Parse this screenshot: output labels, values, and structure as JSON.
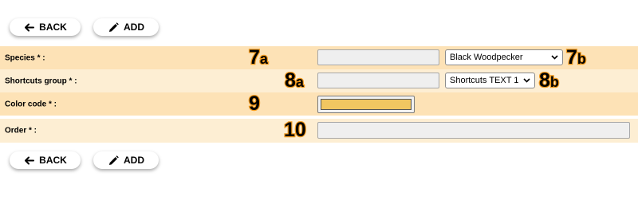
{
  "toolbar_top": {
    "back_label": "BACK",
    "add_label": "ADD"
  },
  "toolbar_bottom": {
    "back_label": "BACK",
    "add_label": "ADD"
  },
  "form": {
    "species": {
      "label": "Species * :",
      "marker_num": "7",
      "marker_letter": "a",
      "input_value": "",
      "select_value": "Black Woodpecker",
      "select_marker_num": "7",
      "select_marker_letter": "b"
    },
    "shortcuts_group": {
      "label": "Shortcuts group * :",
      "marker_num": "8",
      "marker_letter": "a",
      "input_value": "",
      "select_value": "Shortcuts TEXT 1",
      "select_marker_num": "8",
      "select_marker_letter": "b"
    },
    "color_code": {
      "label": "Color code * :",
      "marker_num": "9",
      "color": "#f1c661"
    },
    "order": {
      "label": "Order * :",
      "marker_num": "10",
      "input_value": ""
    }
  },
  "icons": {
    "back": "arrow-left-icon",
    "add": "pencil-icon",
    "select": "chevron-down-icon"
  },
  "colors": {
    "row_dark": "#fde2b6",
    "row_light": "#fdeed3",
    "marker_outline": "#f29a1e"
  }
}
